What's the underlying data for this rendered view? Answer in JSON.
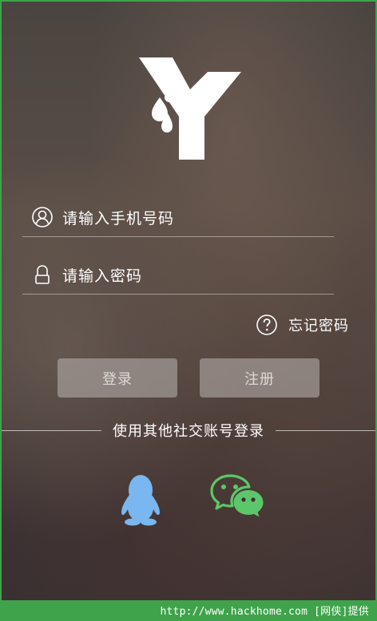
{
  "login": {
    "phone_placeholder": "请输入手机号码",
    "password_placeholder": "请输入密码",
    "forgot_label": "忘记密码",
    "login_label": "登录",
    "register_label": "注册",
    "social_label": "使用其他社交账号登录"
  },
  "icons": {
    "logo": "y-logo",
    "phone": "user-icon",
    "password": "lock-icon",
    "forgot": "question-icon",
    "qq": "qq-penguin-icon",
    "wechat": "wechat-icon"
  },
  "colors": {
    "qq": "#7ab6ef",
    "wechat": "#5cc76a",
    "frame": "#3fa34b"
  },
  "footer": {
    "watermark": "http://www.hackhome.com [网侠]提供"
  }
}
